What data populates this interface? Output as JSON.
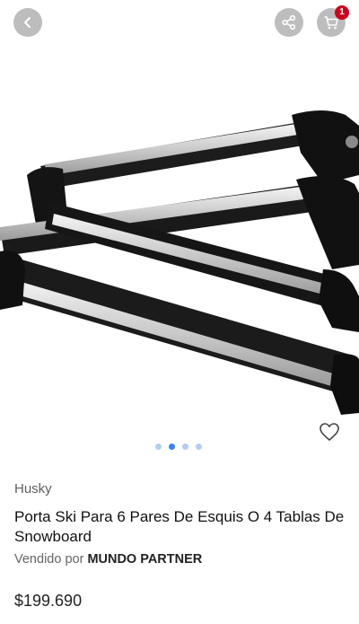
{
  "header": {
    "back_icon": "chevron-left-icon",
    "share_icon": "share-icon",
    "cart_icon": "cart-icon",
    "cart_count": "1",
    "button_bg": "#bdbdbd",
    "badge_color": "#d0021b"
  },
  "gallery": {
    "image": "ski rack product photo",
    "images_count": 4,
    "active_index": 1,
    "favorite_icon": "heart-outline-icon",
    "dot_color": "#b4cdf2",
    "dot_active_color": "#3483fa"
  },
  "product": {
    "brand": "Husky",
    "title": "Porta Ski Para 6 Pares De Esquis O 4 Tablas De Snowboard",
    "sold_by_label": "Vendido por",
    "seller": "MUNDO PARTNER",
    "price": "$199.690"
  }
}
